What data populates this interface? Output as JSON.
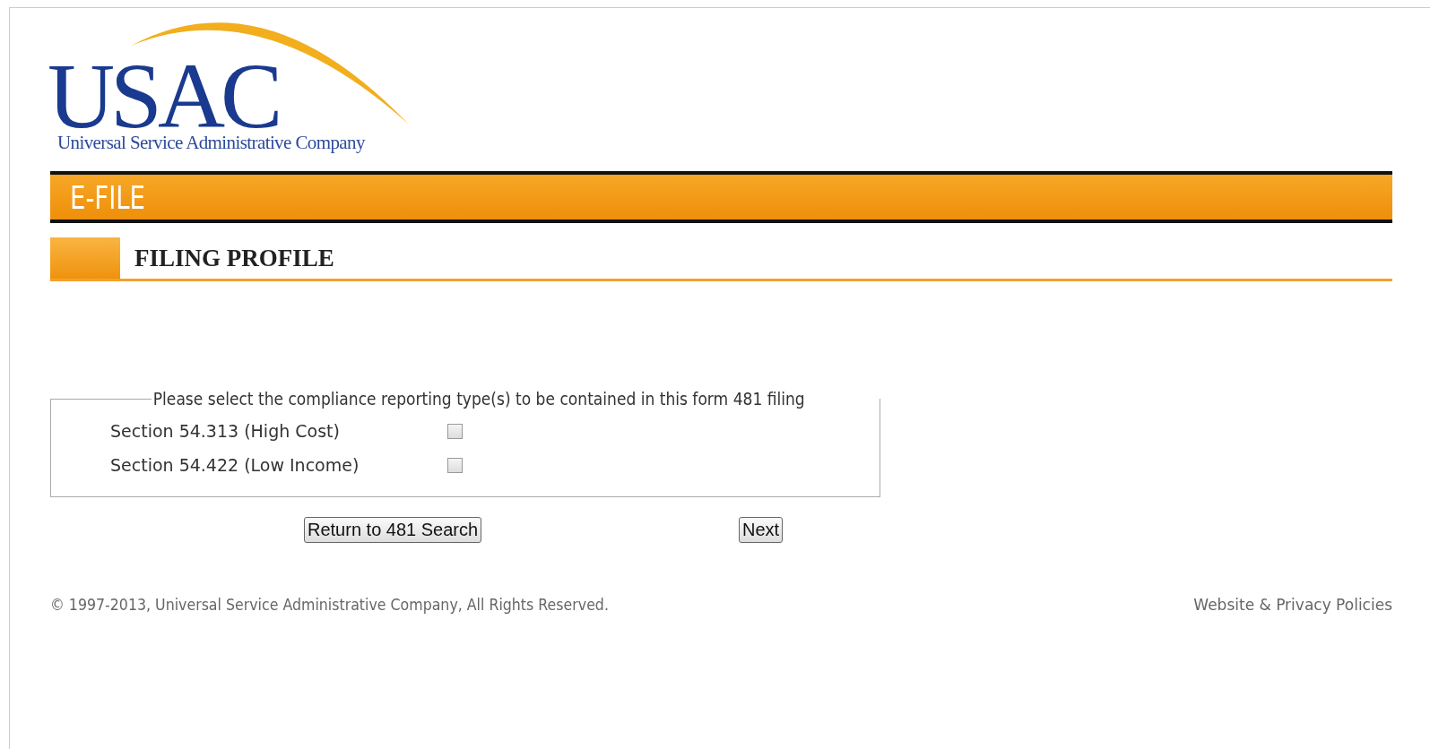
{
  "logo": {
    "wordmark": "USAC",
    "tagline": "Universal Service Administrative Company"
  },
  "banner": {
    "title": "E-FILE"
  },
  "section": {
    "title": "FILING PROFILE"
  },
  "form": {
    "legend": "Please select the compliance reporting type(s) to be contained in this form 481 filing",
    "options": [
      {
        "label": "Section 54.313 (High Cost)",
        "checked": false
      },
      {
        "label": "Section 54.422 (Low Income)",
        "checked": false
      }
    ]
  },
  "buttons": [
    "Return to 481 Search",
    "Next"
  ],
  "footer": {
    "copyright": "© 1997-2013, Universal Service Administrative Company, All Rights Reserved.",
    "link": "Website & Privacy Policies"
  }
}
